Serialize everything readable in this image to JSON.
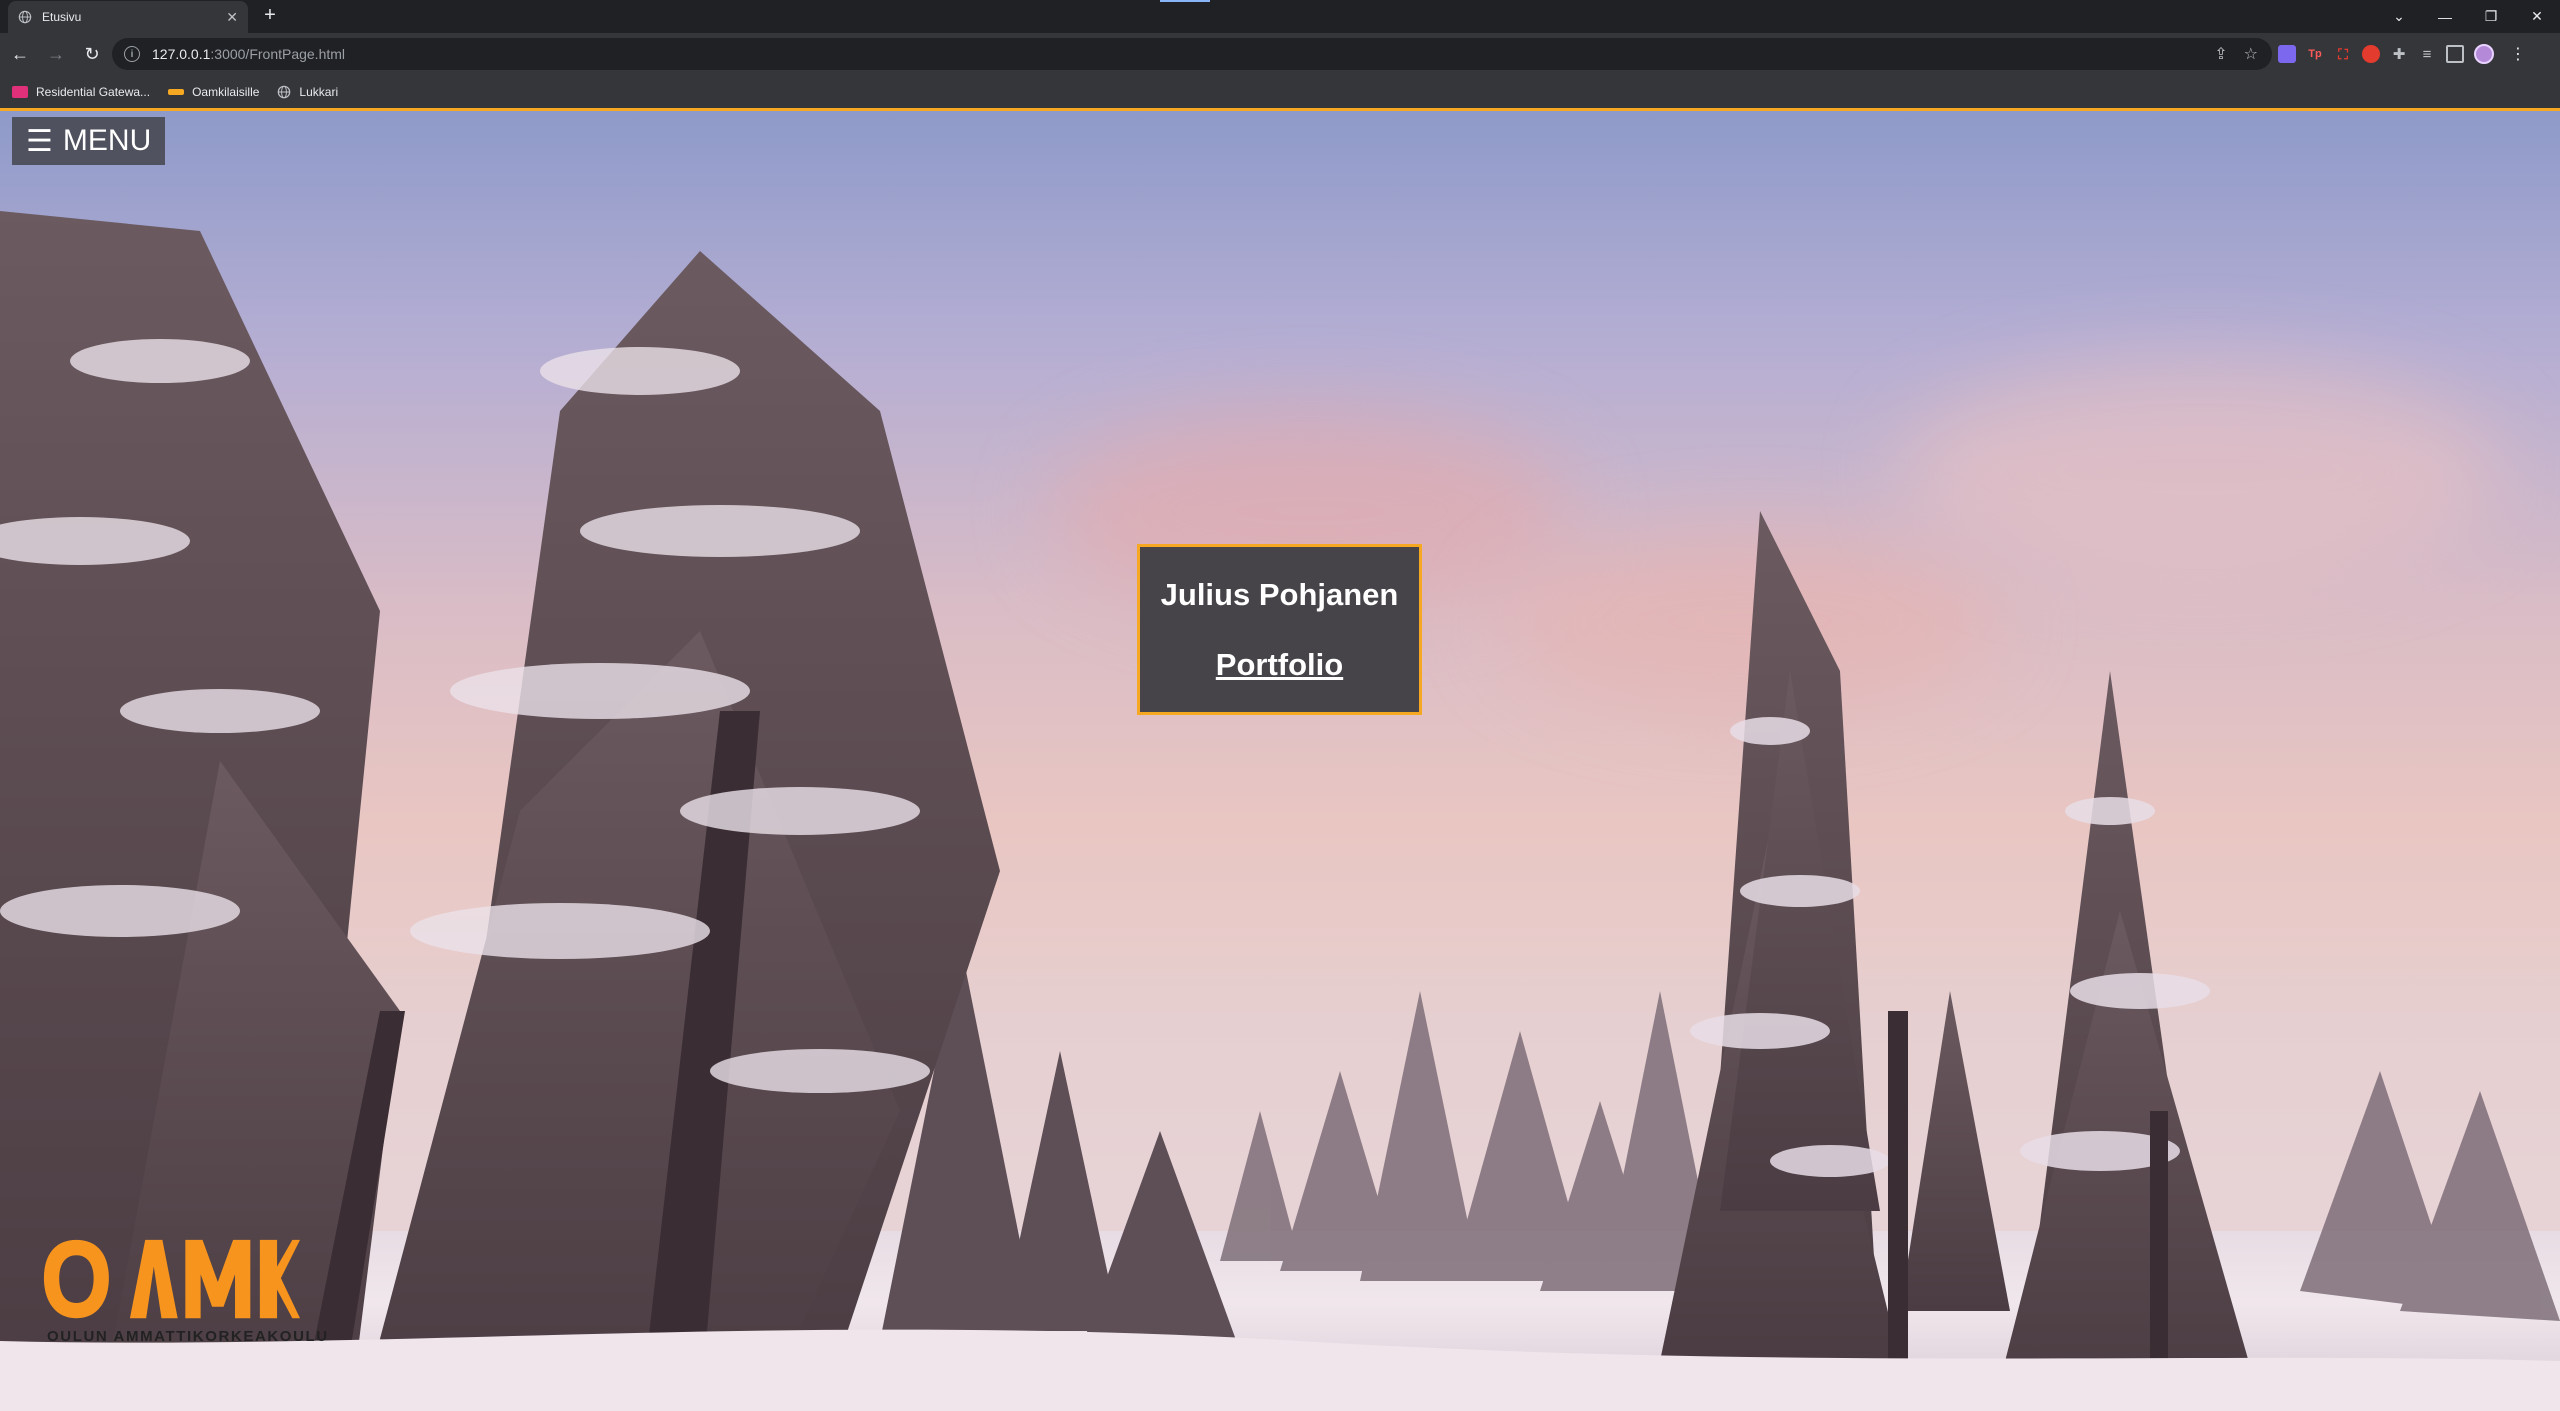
{
  "browser": {
    "tab_title": "Etusivu",
    "tab_close": "✕",
    "new_tab": "+",
    "url_host": "127.0.0.1",
    "url_path": ":3000/FrontPage.html",
    "window_controls": [
      "⌄",
      "—",
      "❐",
      "✕"
    ],
    "bookmarks": [
      {
        "label": "Residential Gatewa...",
        "color": "#e0307a"
      },
      {
        "label": "Oamkilaisille",
        "color": "#f7a823"
      },
      {
        "label": "Lukkari",
        "color": "#9aa0a6"
      }
    ],
    "extension_colors": [
      "#7b68ee",
      "#ff5a5a",
      "#e33b2e",
      "#e33b2e",
      "#bdc1c6",
      "#bdc1c6",
      "#bdc1c6"
    ],
    "extension_icons": [
      "shield-icon",
      "tp-icon",
      "pdf-icon",
      "record-icon",
      "puzzle-icon",
      "playlist-icon",
      "sidepanel-icon"
    ]
  },
  "page": {
    "menu_icon": "☰",
    "menu_label": "MENU",
    "hero_name": "Julius Pohjanen",
    "hero_link": "Portfolio",
    "logo_text": "OULUN AMMATTIKORKEAKOULU",
    "logo_mark": "OAMK",
    "accent_color": "#f7a823",
    "box_color": "#464449"
  }
}
